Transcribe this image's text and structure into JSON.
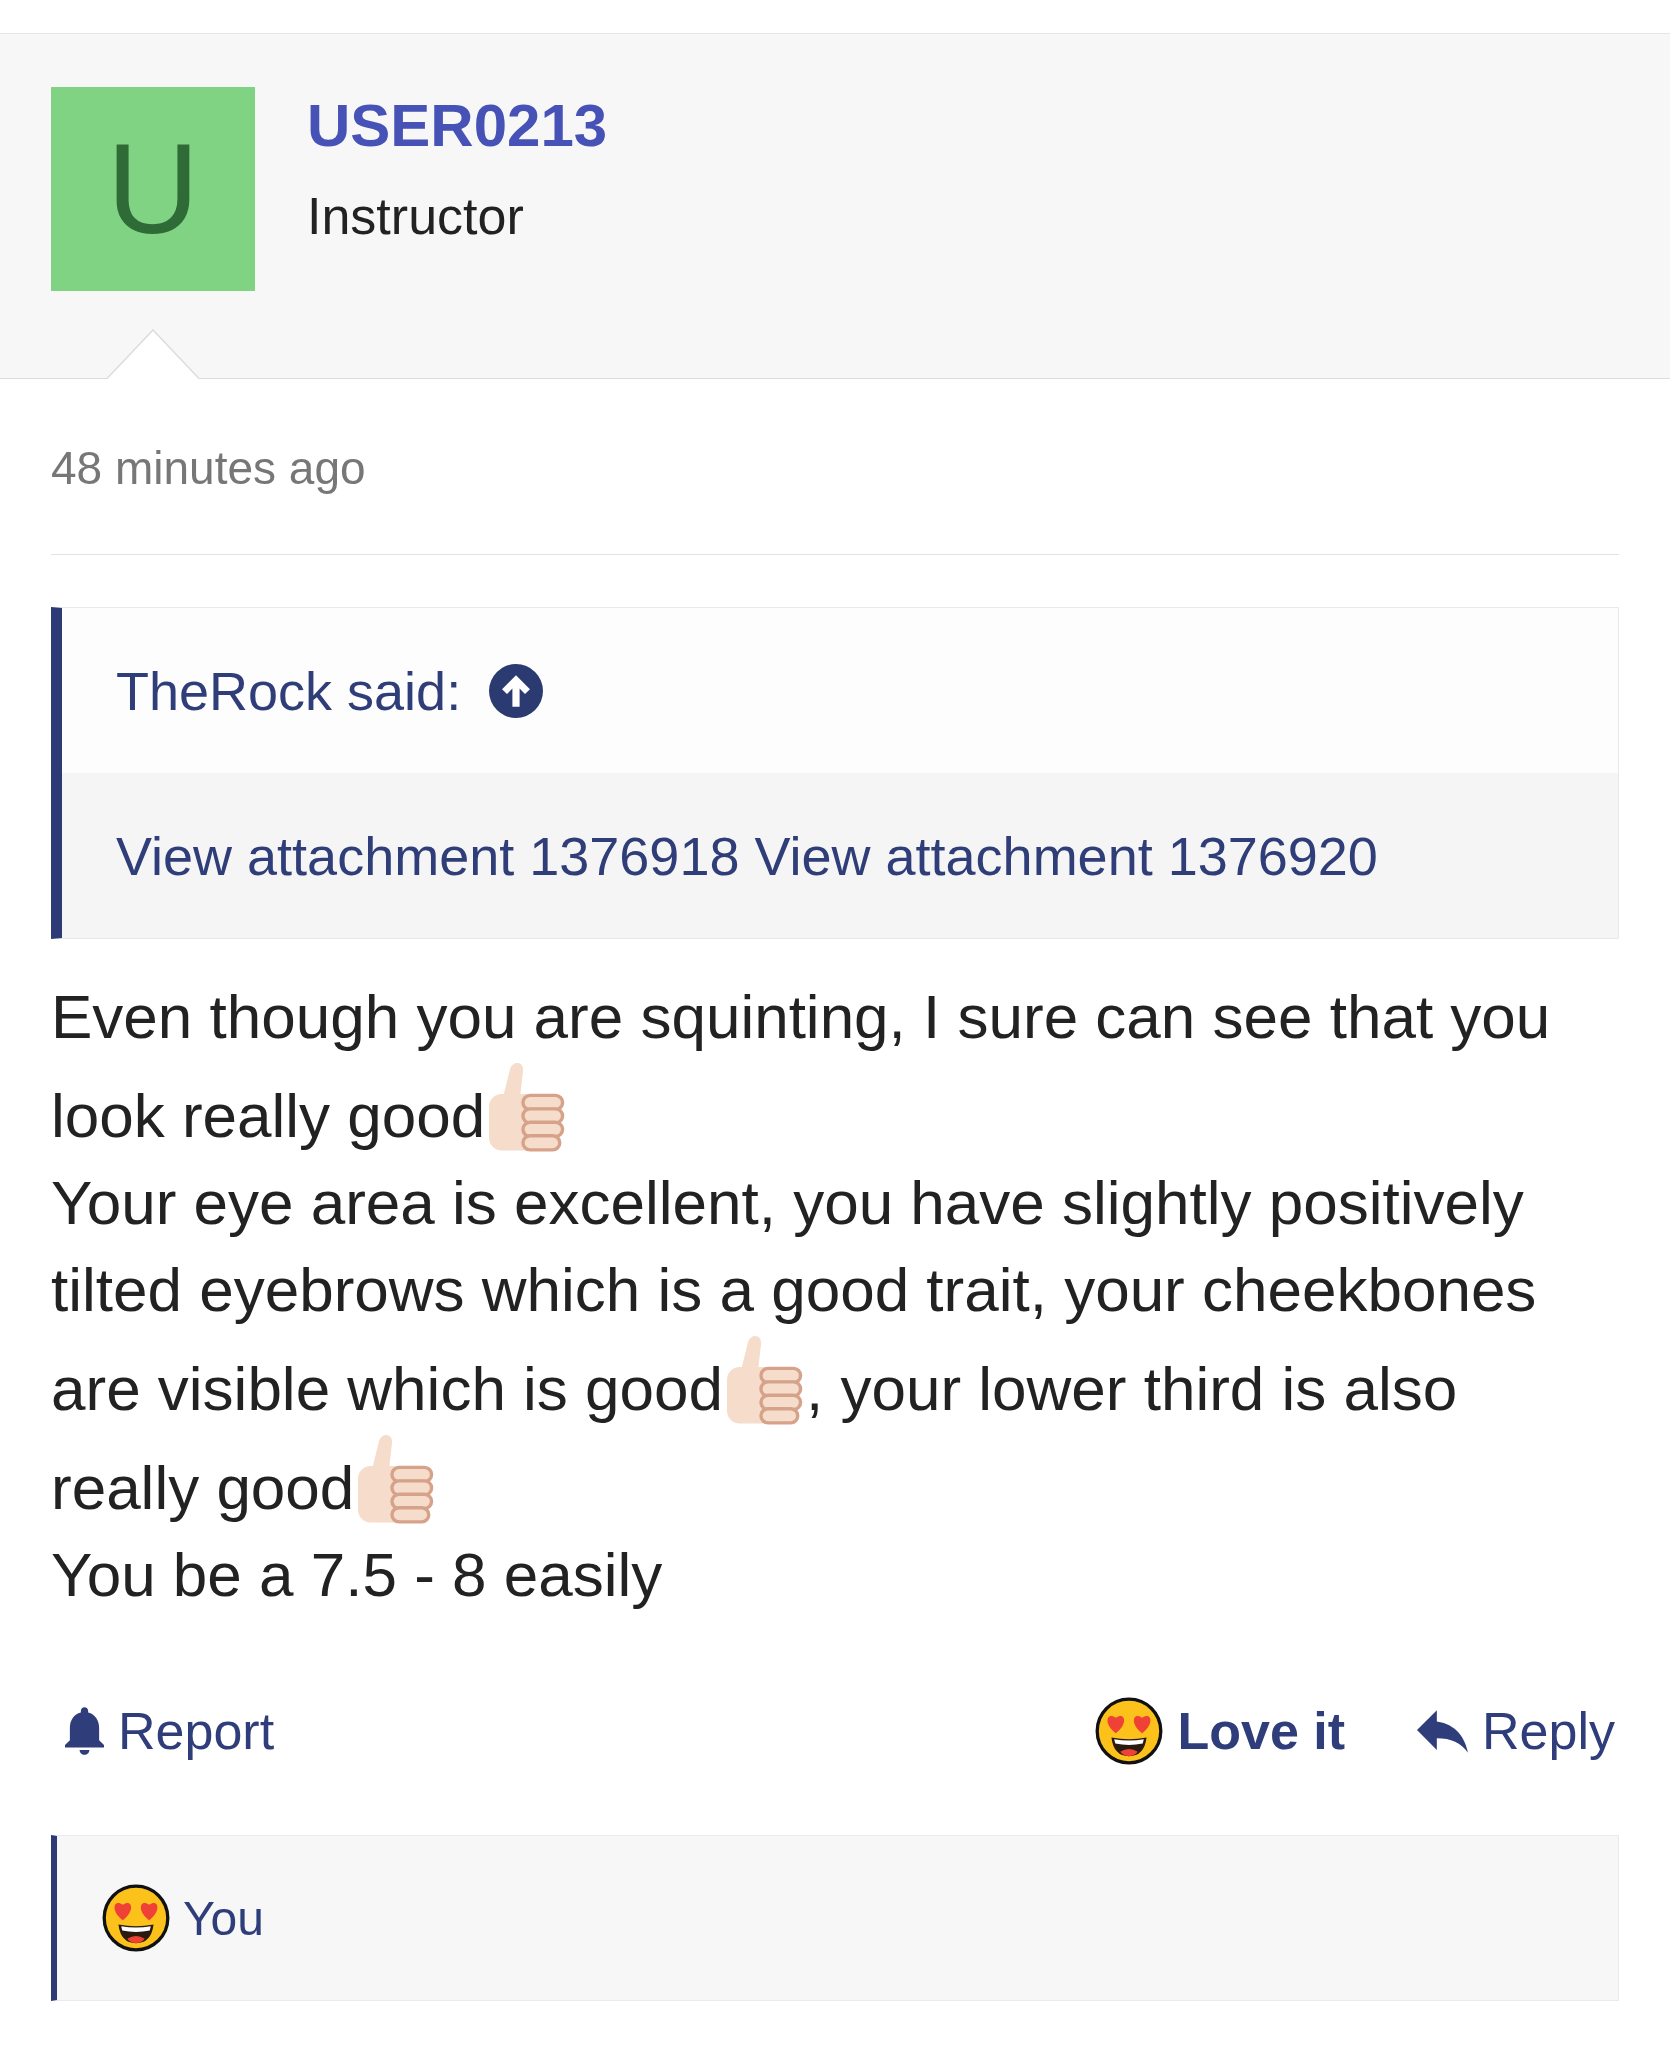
{
  "profile": {
    "avatar_letter": "U",
    "username": "USER0213",
    "role": "Instructor"
  },
  "post": {
    "timestamp": "48 minutes ago",
    "quote": {
      "author": "TheRock said:",
      "attachments": [
        "View attachment 1376918",
        "View attachment 1376920"
      ]
    },
    "body": {
      "rows": [
        {
          "segments": [
            {
              "text": "Even though you are squinting, I sure can see that you",
              "emoji_after": false
            }
          ]
        },
        {
          "segments": [
            {
              "text": "look really good",
              "emoji_after": true
            }
          ]
        },
        {
          "segments": [
            {
              "text": "Your eye area is excellent, you have slightly positively",
              "emoji_after": false
            }
          ]
        },
        {
          "segments": [
            {
              "text": "tilted eyebrows which is a good trait, your cheekbones",
              "emoji_after": false
            }
          ]
        },
        {
          "segments": [
            {
              "text": "are visible which is good",
              "emoji_after": true
            },
            {
              "text": ", your lower third is also",
              "emoji_after": false
            }
          ]
        },
        {
          "segments": [
            {
              "text": "really good",
              "emoji_after": true
            }
          ]
        },
        {
          "segments": [
            {
              "text": "You be a 7.5 - 8 easily",
              "emoji_after": false
            }
          ]
        }
      ]
    },
    "actions": {
      "left": [
        {
          "kind": "report",
          "label": "Report",
          "active": false
        }
      ],
      "right": [
        {
          "kind": "reaction",
          "label": "Love it",
          "active": true
        },
        {
          "kind": "reply",
          "label": "Reply",
          "active": false
        }
      ]
    },
    "reactions_bar": {
      "reactors": "You"
    }
  }
}
